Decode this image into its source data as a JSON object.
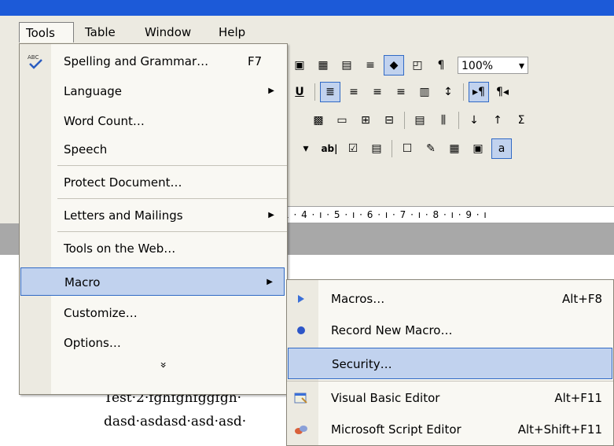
{
  "menubar": {
    "items": [
      {
        "label": "Tools",
        "active": true
      },
      {
        "label": "Table"
      },
      {
        "label": "Window"
      },
      {
        "label": "Help"
      }
    ]
  },
  "toolbar": {
    "zoom": "100%"
  },
  "ruler": {
    "text": "1 · 4 · ı · 5 · ı · 6 · ı · 7 · ı · 8 · ı · 9 · ı"
  },
  "document": {
    "line1": "Test·2·fghfghfggfgh·",
    "line2": "dasd·asdasd·asd·asd·"
  },
  "tools_menu": {
    "items": [
      {
        "label": "Spelling and Grammar…",
        "shortcut": "F7",
        "icon": "spelling-icon"
      },
      {
        "label": "Language",
        "submenu": true
      },
      {
        "label": "Word Count…"
      },
      {
        "label": "Speech"
      },
      {
        "label": "Protect Document…"
      },
      {
        "label": "Letters and Mailings",
        "submenu": true
      },
      {
        "label": "Tools on the Web…"
      },
      {
        "label": "Macro",
        "submenu": true,
        "highlighted": true
      },
      {
        "label": "Customize…"
      },
      {
        "label": "Options…"
      }
    ],
    "expand_glyph": "»"
  },
  "macro_submenu": {
    "items": [
      {
        "label": "Macros…",
        "shortcut": "Alt+F8",
        "icon": "macro-play-icon"
      },
      {
        "label": "Record New Macro…",
        "icon": "record-icon"
      },
      {
        "label": "Security…",
        "highlighted": true
      },
      {
        "label": "Visual Basic Editor",
        "shortcut": "Alt+F11",
        "icon": "vb-editor-icon"
      },
      {
        "label": "Microsoft Script Editor",
        "shortcut": "Alt+Shift+F11",
        "icon": "script-editor-icon"
      }
    ]
  },
  "colors": {
    "titlebar": "#1c5ad8",
    "menu_bg": "#f9f8f3",
    "highlight": "#c1d2ee",
    "highlight_border": "#316ac5"
  }
}
